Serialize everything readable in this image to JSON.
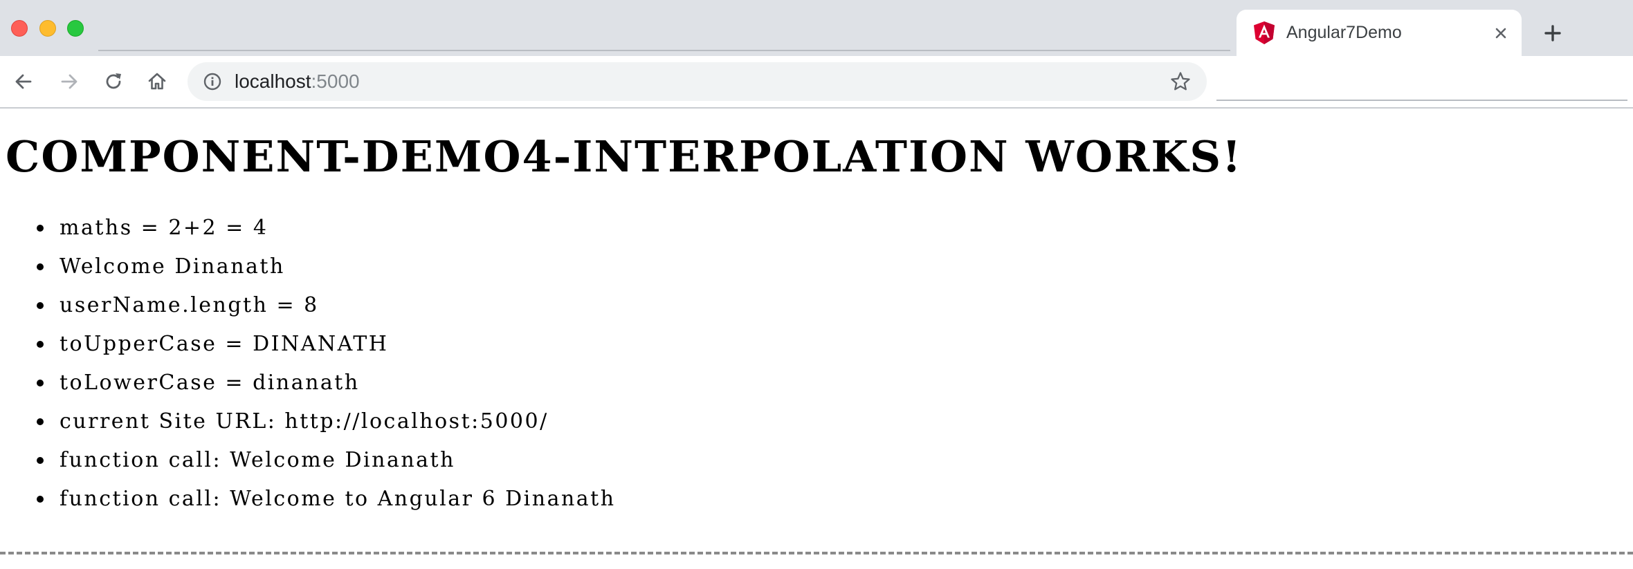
{
  "browser": {
    "tab": {
      "title": "Angular7Demo",
      "favicon": "angular-logo-icon",
      "close_icon": "close-icon"
    },
    "new_tab_icon": "plus-icon",
    "nav": {
      "back_icon": "arrow-left-icon",
      "forward_icon": "arrow-right-icon",
      "reload_icon": "reload-icon",
      "home_icon": "home-icon"
    },
    "address_bar": {
      "info_icon": "info-icon",
      "host": "localhost",
      "port": ":5000",
      "bookmark_icon": "star-icon"
    },
    "colors": {
      "titlebar": "#dee1e6",
      "angular_red": "#dd0031",
      "traffic_red": "#fe5f57",
      "traffic_yellow": "#febc2e",
      "traffic_green": "#28c840"
    }
  },
  "page": {
    "heading": "COMPONENT-DEMO4-INTERPOLATION WORKS!",
    "items": [
      "maths = 2+2 = 4",
      "Welcome Dinanath",
      "userName.length = 8",
      "toUpperCase = DINANATH",
      "toLowerCase = dinanath",
      "current Site URL: http://localhost:5000/",
      "function call: Welcome Dinanath",
      "function call: Welcome to Angular 6 Dinanath"
    ]
  }
}
